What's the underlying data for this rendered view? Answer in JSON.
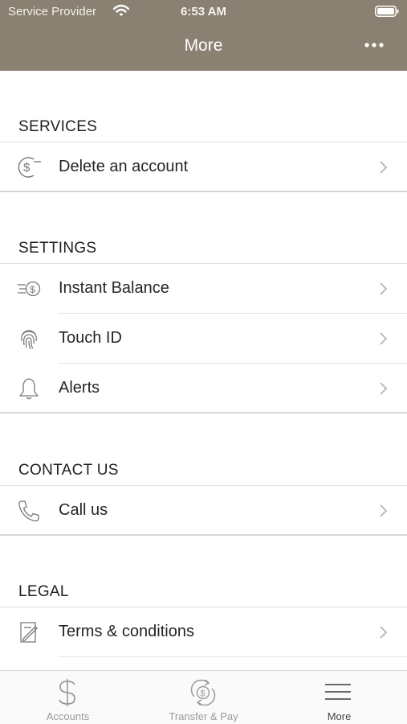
{
  "status_bar": {
    "carrier": "Service Provider",
    "time": "6:53 AM"
  },
  "header": {
    "title": "More"
  },
  "colors": {
    "header_bg": "#8b8172",
    "icon": "#7a7a7a",
    "chevron": "#b5b5b5"
  },
  "sections": [
    {
      "title": "SERVICES",
      "items": [
        {
          "label": "Delete an account",
          "icon": "dollar-cycle-icon"
        }
      ]
    },
    {
      "title": "SETTINGS",
      "items": [
        {
          "label": "Instant Balance",
          "icon": "instant-balance-icon"
        },
        {
          "label": "Touch ID",
          "icon": "fingerprint-icon"
        },
        {
          "label": "Alerts",
          "icon": "bell-icon"
        }
      ]
    },
    {
      "title": "CONTACT US",
      "items": [
        {
          "label": "Call us",
          "icon": "phone-icon"
        }
      ]
    },
    {
      "title": "LEGAL",
      "items": [
        {
          "label": "Terms & conditions",
          "icon": "document-edit-icon"
        }
      ]
    }
  ],
  "tabbar": {
    "tabs": [
      {
        "label": "Accounts",
        "icon": "dollar-icon",
        "active": false
      },
      {
        "label": "Transfer & Pay",
        "icon": "transfer-icon",
        "active": false
      },
      {
        "label": "More",
        "icon": "menu-icon",
        "active": true
      }
    ]
  }
}
